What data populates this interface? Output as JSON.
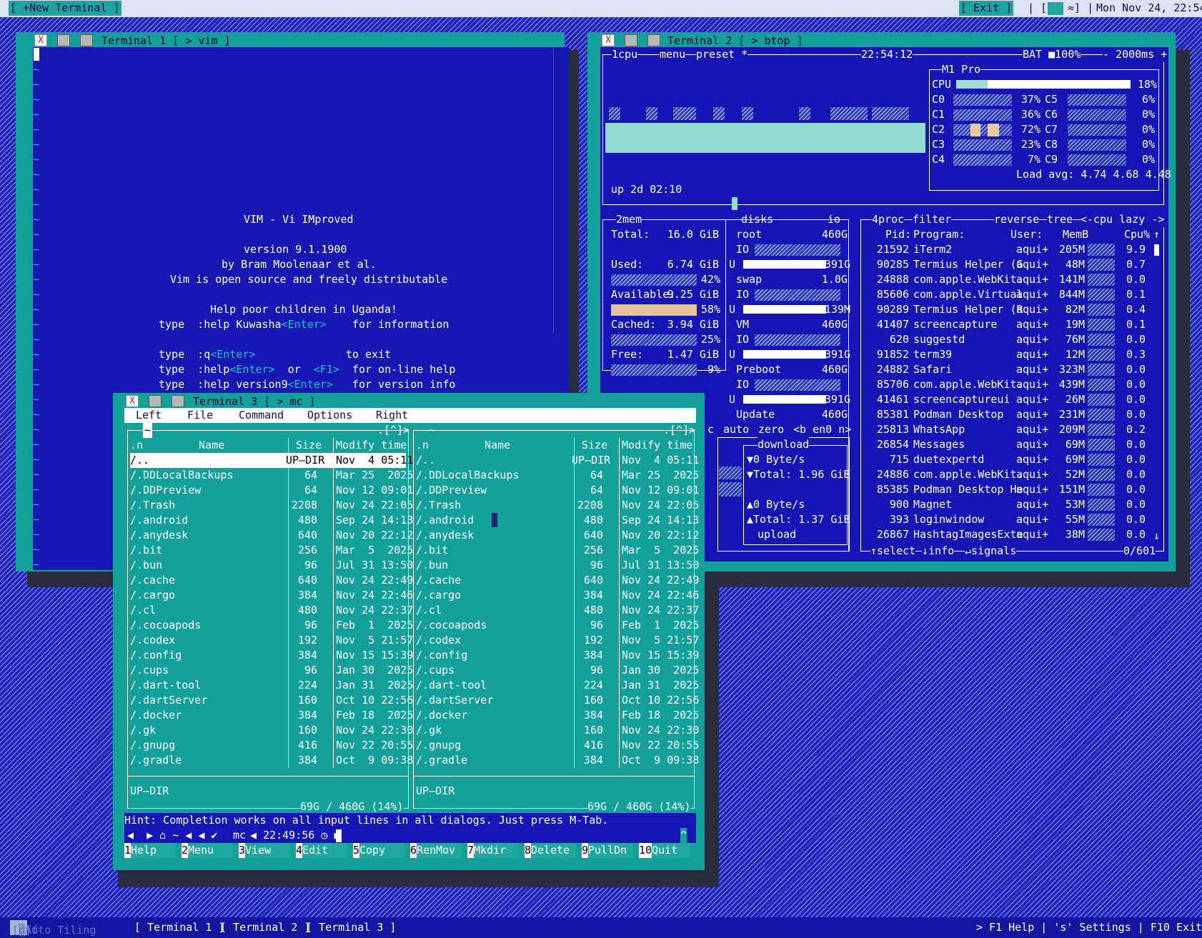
{
  "topbar": {
    "new_terminal": "[ +New Terminal ]",
    "exit": "[ Exit ]",
    "tray": "| [",
    "tray2": "≈] |",
    "clock": "Mon Nov 24, 22:54"
  },
  "bottombar": {
    "toggle": "[off",
    "tiling": "Auto Tiling",
    "tasks": [
      "[ Terminal 1 ]",
      "[ Terminal 2 ]",
      "[ Terminal 3 ]"
    ],
    "help": "> F1 Help | 's' Settings | F10 Exit <"
  },
  "windows": {
    "t1": {
      "title": "Terminal 1 [ > vim ]",
      "close": "X"
    },
    "t2": {
      "title": "Terminal 2 [ > btop ]",
      "close": "X"
    },
    "t3": {
      "title": "Terminal 3 [ > mc ]",
      "close": "X"
    }
  },
  "vim": {
    "title": "VIM - Vi IMproved",
    "version": "version 9.1.1900",
    "author": "by Bram Moolenaar et al.",
    "license": "Vim is open source and freely distributable",
    "help_poor": "Help poor children in Uganda!",
    "lines": [
      {
        "a": "type  :help Kuwasha",
        "b": "<Enter>",
        "c": "    for information"
      },
      {
        "a": "type  :q",
        "b": "<Enter>",
        "c": "              to exit"
      },
      {
        "a": "type  :help",
        "b": "<Enter>",
        "c": "  or  ",
        "d": "<F1>",
        "e": "  for on-line help"
      },
      {
        "a": "type  :help version9",
        "b": "<Enter>",
        "c": "   for version info"
      }
    ],
    "tilde": "~"
  },
  "btop": {
    "cpu_hdr": "1cpu",
    "menu": "menu",
    "preset": "preset *",
    "time": "22:54:12",
    "bat": "BAT",
    "bat_pct": "100%",
    "interval": "- 2000ms +",
    "cpu_name": "M1 Pro",
    "cpu_label": "CPU",
    "cpu_pct": "18%",
    "cpu_fill": 0.18,
    "cores": [
      {
        "l": "C0",
        "v": "37%",
        "r": "C5",
        "rv": "6%"
      },
      {
        "l": "C1",
        "v": "36%",
        "r": "C6",
        "rv": "0%"
      },
      {
        "l": "C2",
        "v": "72%",
        "r": "C7",
        "rv": "0%"
      },
      {
        "l": "C3",
        "v": "23%",
        "r": "C8",
        "rv": "0%"
      },
      {
        "l": "C4",
        "v": "7%",
        "r": "C9",
        "rv": "0%"
      }
    ],
    "load": "Load avg: 4.74 4.68 4.48",
    "uptime": "up 2d 02:10",
    "mem_hdr": "2mem",
    "disks_hdr": "disks",
    "io_hdr": "io",
    "mem": [
      {
        "k": "Total:",
        "v": "16.0 GiB"
      },
      {
        "k": "Used:",
        "v": "6.74 GiB",
        "pct": "42%",
        "fill": 0.42
      },
      {
        "k": "Available:",
        "v": "9.25 GiB",
        "pct": "58%",
        "fill": 0.58
      },
      {
        "k": "Cached:",
        "v": "3.94 GiB",
        "pct": "25%",
        "fill": 0.25
      },
      {
        "k": "Free:",
        "v": "1.47 GiB",
        "pct": "9%",
        "fill": 0.09
      }
    ],
    "disks": [
      {
        "name": "root",
        "size": "460G",
        "io": "IO",
        "u": "U",
        "used": "391G"
      },
      {
        "name": "swap",
        "size": "1.0G",
        "io": "IO",
        "u": "U",
        "used": "139M"
      },
      {
        "name": "VM",
        "size": "460G",
        "io": "IO",
        "u": "U",
        "used": "391G"
      },
      {
        "name": "Preboot",
        "size": "460G",
        "io": "IO",
        "u": "U",
        "used": "391G"
      },
      {
        "name": "Update",
        "size": "460G"
      }
    ],
    "net": {
      "c": "c",
      "auto": "auto",
      "zero": "zero",
      "iface": "<b en0 n>",
      "download": "download",
      "dl_rate": "▼0 Byte/s",
      "dl_total": "▼Total: 1.96 GiB",
      "ul_rate": "▲0 Byte/s",
      "ul_total": "▲Total: 1.37 GiB",
      "upload": "upload"
    },
    "proc_hdr": "4proc",
    "filter": "filter",
    "reverse": "reverse",
    "tree": "tree",
    "sort": "<-cpu lazy ->",
    "proc_cols": {
      "pid": "Pid:",
      "prog": "Program:",
      "user": "User:",
      "mem": "MemB",
      "cpu": "Cpu%"
    },
    "procs": [
      {
        "pid": "21592",
        "prog": "iTerm2",
        "user": "aqui+",
        "mem": "205M",
        "cpu": "9.9"
      },
      {
        "pid": "90285",
        "prog": "Termius Helper (G",
        "user": "aqui+",
        "mem": "48M",
        "cpu": "0.7"
      },
      {
        "pid": "24888",
        "prog": "com.apple.WebKit.",
        "user": "aqui+",
        "mem": "141M",
        "cpu": "0.0"
      },
      {
        "pid": "85606",
        "prog": "com.apple.Virtual",
        "user": "aqui+",
        "mem": "844M",
        "cpu": "0.1"
      },
      {
        "pid": "90289",
        "prog": "Termius Helper (R",
        "user": "aqui+",
        "mem": "82M",
        "cpu": "0.4"
      },
      {
        "pid": "41407",
        "prog": "screencapture",
        "user": "aqui+",
        "mem": "19M",
        "cpu": "0.1"
      },
      {
        "pid": "620",
        "prog": "suggestd",
        "user": "aqui+",
        "mem": "76M",
        "cpu": "0.0"
      },
      {
        "pid": "91852",
        "prog": "term39",
        "user": "aqui+",
        "mem": "12M",
        "cpu": "0.3"
      },
      {
        "pid": "24882",
        "prog": "Safari",
        "user": "aqui+",
        "mem": "323M",
        "cpu": "0.0"
      },
      {
        "pid": "85706",
        "prog": "com.apple.WebKit.",
        "user": "aqui+",
        "mem": "439M",
        "cpu": "0.0"
      },
      {
        "pid": "41461",
        "prog": "screencaptureui",
        "user": "aqui+",
        "mem": "26M",
        "cpu": "0.0"
      },
      {
        "pid": "85381",
        "prog": "Podman Desktop",
        "user": "aqui+",
        "mem": "231M",
        "cpu": "0.0"
      },
      {
        "pid": "25813",
        "prog": "WhatsApp",
        "user": "aqui+",
        "mem": "209M",
        "cpu": "0.2"
      },
      {
        "pid": "26854",
        "prog": "Messages",
        "user": "aqui+",
        "mem": "69M",
        "cpu": "0.0"
      },
      {
        "pid": "715",
        "prog": "duetexpertd",
        "user": "aqui+",
        "mem": "69M",
        "cpu": "0.0"
      },
      {
        "pid": "24886",
        "prog": "com.apple.WebKit.",
        "user": "aqui+",
        "mem": "52M",
        "cpu": "0.0"
      },
      {
        "pid": "85385",
        "prog": "Podman Desktop He",
        "user": "aqui+",
        "mem": "151M",
        "cpu": "0.0"
      },
      {
        "pid": "900",
        "prog": "Magnet",
        "user": "aqui+",
        "mem": "53M",
        "cpu": "0.0"
      },
      {
        "pid": "393",
        "prog": "loginwindow",
        "user": "aqui+",
        "mem": "55M",
        "cpu": "0.0"
      },
      {
        "pid": "26867",
        "prog": "HashtagImagesExte",
        "user": "aqui+",
        "mem": "38M",
        "cpu": "0.0"
      }
    ],
    "proc_footer": {
      "select": "↑select",
      "info": "↓info",
      "signals": "↵signals",
      "count": "0/601"
    }
  },
  "mc": {
    "menu": [
      "Left",
      "File",
      "Command",
      "Options",
      "Right"
    ],
    "cols": {
      "n": ".n",
      "name": "Name",
      "size": "Size",
      "modify": "Modify time"
    },
    "left_path": "~",
    "right_path": "~",
    "corner": ".[^]>",
    "files": [
      {
        "name": "/..",
        "size": "UP—DIR",
        "date": "Nov  4 05:11"
      },
      {
        "name": "/.DDLocalBackups",
        "size": "64",
        "date": "Mar 25  2025"
      },
      {
        "name": "/.DDPreview",
        "size": "64",
        "date": "Nov 12 09:01"
      },
      {
        "name": "/.Trash",
        "size": "2208",
        "date": "Nov 24 22:05"
      },
      {
        "name": "/.android",
        "size": "480",
        "date": "Sep 24 14:13"
      },
      {
        "name": "/.anydesk",
        "size": "640",
        "date": "Nov 20 22:12"
      },
      {
        "name": "/.bit",
        "size": "256",
        "date": "Mar  5  2025"
      },
      {
        "name": "/.bun",
        "size": "96",
        "date": "Jul 31 13:50"
      },
      {
        "name": "/.cache",
        "size": "640",
        "date": "Nov 24 22:49"
      },
      {
        "name": "/.cargo",
        "size": "384",
        "date": "Nov 24 22:46"
      },
      {
        "name": "/.cl",
        "size": "480",
        "date": "Nov 24 22:37"
      },
      {
        "name": "/.cocoapods",
        "size": "96",
        "date": "Feb  1  2025"
      },
      {
        "name": "/.codex",
        "size": "192",
        "date": "Nov  5 21:57"
      },
      {
        "name": "/.config",
        "size": "384",
        "date": "Nov 15 15:39"
      },
      {
        "name": "/.cups",
        "size": "96",
        "date": "Jan 30  2025"
      },
      {
        "name": "/.dart-tool",
        "size": "224",
        "date": "Jan 31  2025"
      },
      {
        "name": "/.dartServer",
        "size": "160",
        "date": "Oct 10 22:56"
      },
      {
        "name": "/.docker",
        "size": "384",
        "date": "Feb 18  2025"
      },
      {
        "name": "/.gk",
        "size": "160",
        "date": "Nov 24 22:30"
      },
      {
        "name": "/.gnupg",
        "size": "416",
        "date": "Nov 22 20:55"
      },
      {
        "name": "/.gradle",
        "size": "384",
        "date": "Oct  9 09:38"
      }
    ],
    "status": "UP—DIR",
    "disk": "69G / 460G (14%)",
    "hint": "Hint: Completion works on all input lines in all dialogs. Just press M-Tab.",
    "prompt": "mc",
    "prompt_time": "22:49:56",
    "fkeys": [
      {
        "n": "1",
        "l": "Help"
      },
      {
        "n": "2",
        "l": "Menu"
      },
      {
        "n": "3",
        "l": "View"
      },
      {
        "n": "4",
        "l": "Edit"
      },
      {
        "n": "5",
        "l": "Copy"
      },
      {
        "n": "6",
        "l": "RenMov"
      },
      {
        "n": "7",
        "l": "Mkdir"
      },
      {
        "n": "8",
        "l": "Delete"
      },
      {
        "n": "9",
        "l": "PullDn"
      },
      {
        "n": "10",
        "l": "Quit"
      }
    ]
  }
}
